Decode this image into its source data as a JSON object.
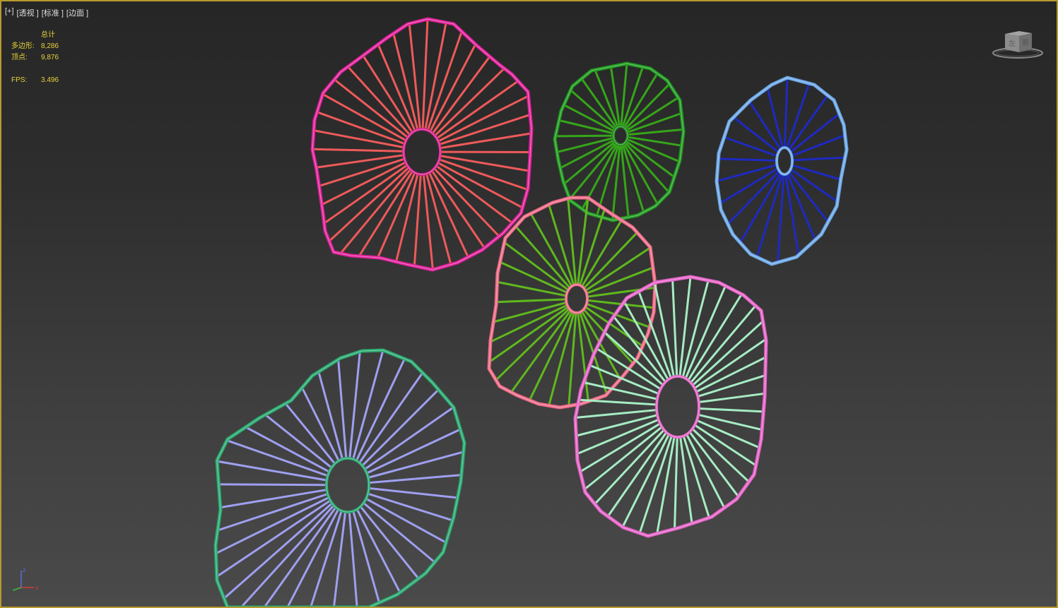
{
  "viewport": {
    "labels": [
      "[+]",
      "[透视 ]",
      "[标准 ]",
      "[边面 ]"
    ]
  },
  "stats": {
    "header": "总计",
    "polygons_label": "多边形:",
    "polygons_value": "8,286",
    "vertices_label": "顶点:",
    "vertices_value": "9,876",
    "fps_label": "FPS:",
    "fps_value": "3.496"
  },
  "viewcube": {
    "face_front": "左",
    "face_right": "前"
  },
  "axis": {
    "x": "x",
    "z": "z"
  },
  "scene_objects": [
    {
      "name": "leaf-red",
      "rim_color": "#e0209a",
      "spoke_color": "#ee5a5a",
      "hub_color": "#d41f8c",
      "spokes": 40
    },
    {
      "name": "leaf-green",
      "rim_color": "#1c9a1c",
      "spoke_color": "#36a51a",
      "hub_color": "#1f8a1f",
      "spokes": 28
    },
    {
      "name": "leaf-blue",
      "rim_color": "#6aa6e6",
      "spoke_color": "#1e2ac0",
      "hub_color": "#6aa6e6",
      "spokes": 22
    },
    {
      "name": "leaf-lime",
      "rim_color": "#ee6a86",
      "spoke_color": "#5fb81e",
      "hub_color": "#ee6a86",
      "spokes": 30
    },
    {
      "name": "leaf-mint",
      "rim_color": "#e663c8",
      "spoke_color": "#a6ecc3",
      "hub_color": "#e663c8",
      "spokes": 40
    },
    {
      "name": "leaf-violet",
      "rim_color": "#27a86e",
      "spoke_color": "#9f9ff0",
      "hub_color": "#27a86e",
      "spokes": 36
    }
  ]
}
